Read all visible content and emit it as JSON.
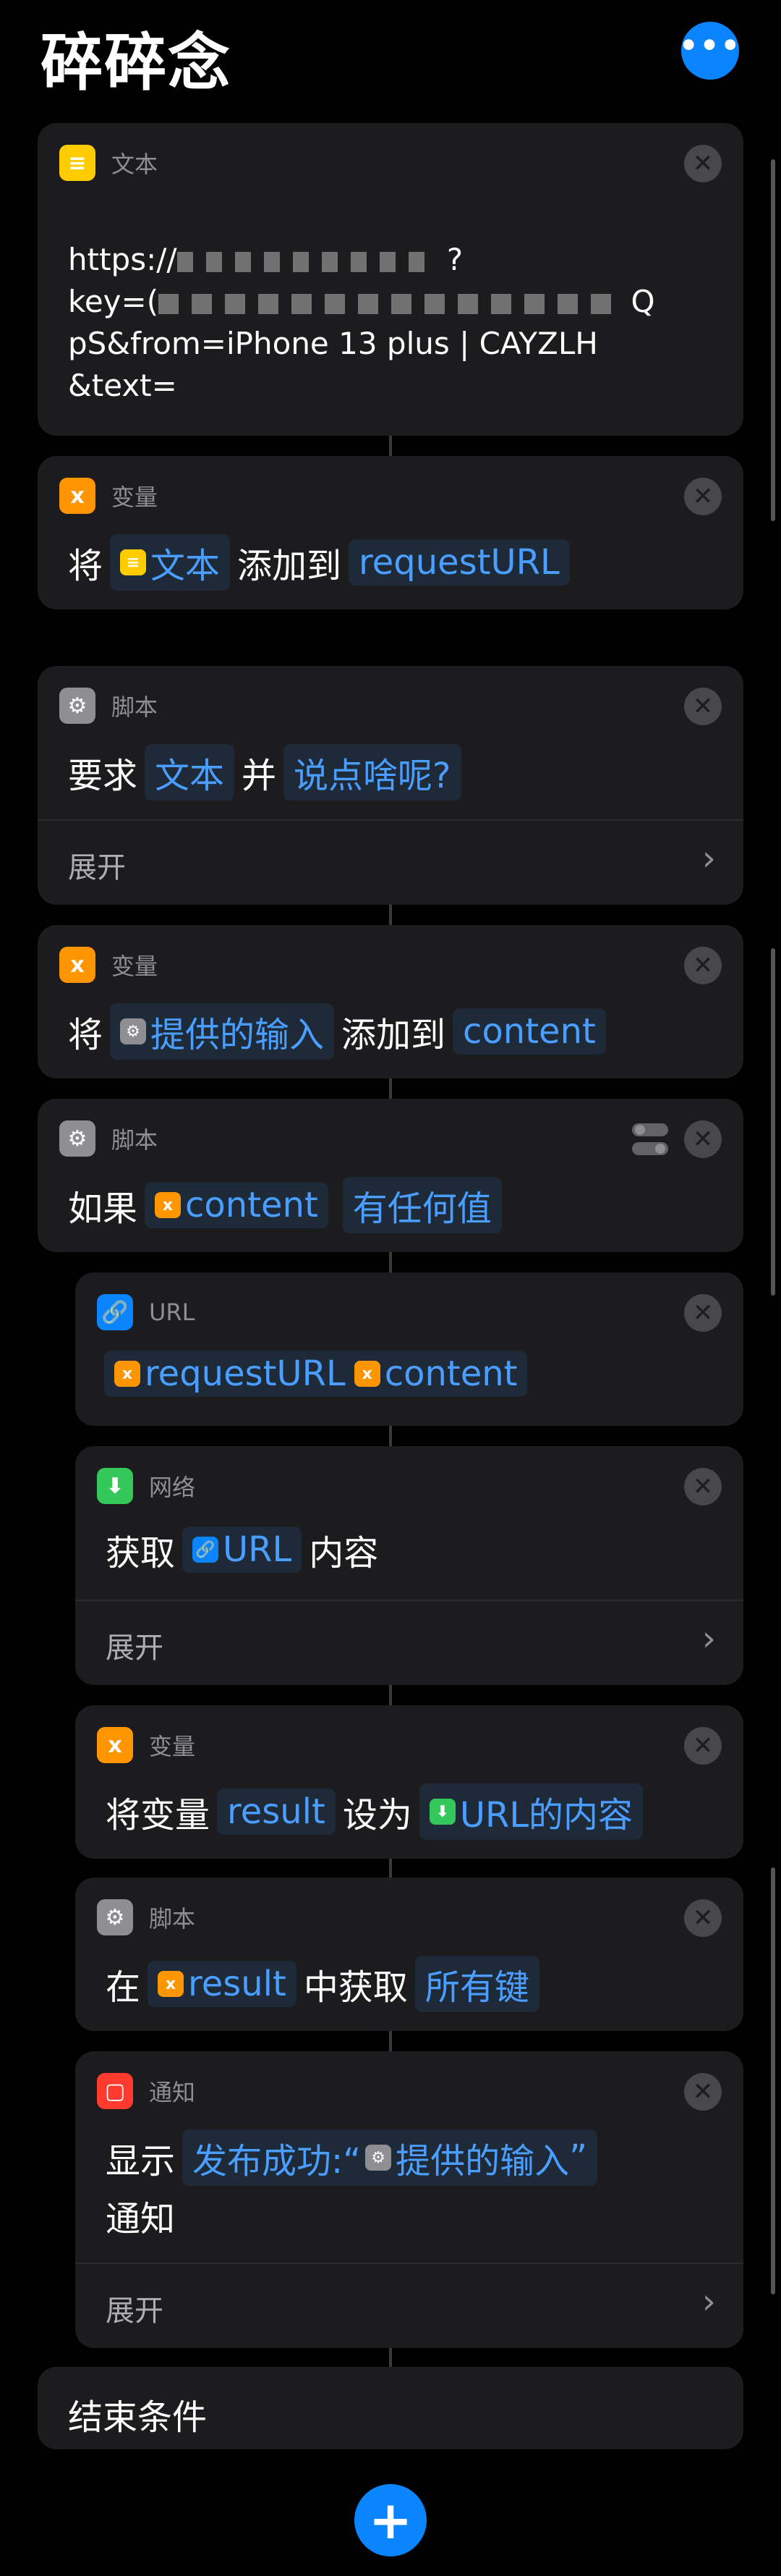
{
  "app": {
    "title": "碎碎念"
  },
  "actions": {
    "text": {
      "label": "文本",
      "line1": "https://",
      "line1_end": "?",
      "line2": "key=(",
      "line2_end": "Q",
      "line3": "pS&from=iPhone 13 plus | CAYZLH",
      "line4": "&text="
    },
    "var1": {
      "label": "变量",
      "p1": "将",
      "token": "文本",
      "p2": "添加到",
      "target": "requestURL"
    },
    "script1": {
      "label": "脚本",
      "p1": "要求",
      "token": "文本",
      "p2": "并",
      "prompt": "说点啥呢?",
      "expand": "展开"
    },
    "var2": {
      "label": "变量",
      "p1": "将",
      "token": "提供的输入",
      "p2": "添加到",
      "target": "content"
    },
    "if": {
      "label": "脚本",
      "p1": "如果",
      "token": "content",
      "condition": "有任何值"
    },
    "url": {
      "label": "URL",
      "token1": "requestURL",
      "token2": "content"
    },
    "network": {
      "label": "网络",
      "p1": "获取",
      "token": "URL",
      "p2": "内容",
      "expand": "展开"
    },
    "var3": {
      "label": "变量",
      "p1": "将变量",
      "var": "result",
      "p2": "设为",
      "token": "URL的内容"
    },
    "script2": {
      "label": "脚本",
      "p1": "在",
      "token": "result",
      "p2": "中获取",
      "value": "所有键"
    },
    "notify": {
      "label": "通知",
      "p1": "显示",
      "msg_start": "发布成功:“",
      "token": "提供的输入",
      "msg_end": "”",
      "p2": "通知",
      "expand": "展开"
    },
    "end": {
      "label": "结束条件"
    }
  },
  "icons": {
    "more": "ellipsis-icon",
    "add": "plus-icon",
    "close": "close-icon"
  },
  "colors": {
    "accent": "#0a84ff",
    "token_text": "#4a9eff",
    "card": "#1c1c1e",
    "background": "#000000"
  }
}
